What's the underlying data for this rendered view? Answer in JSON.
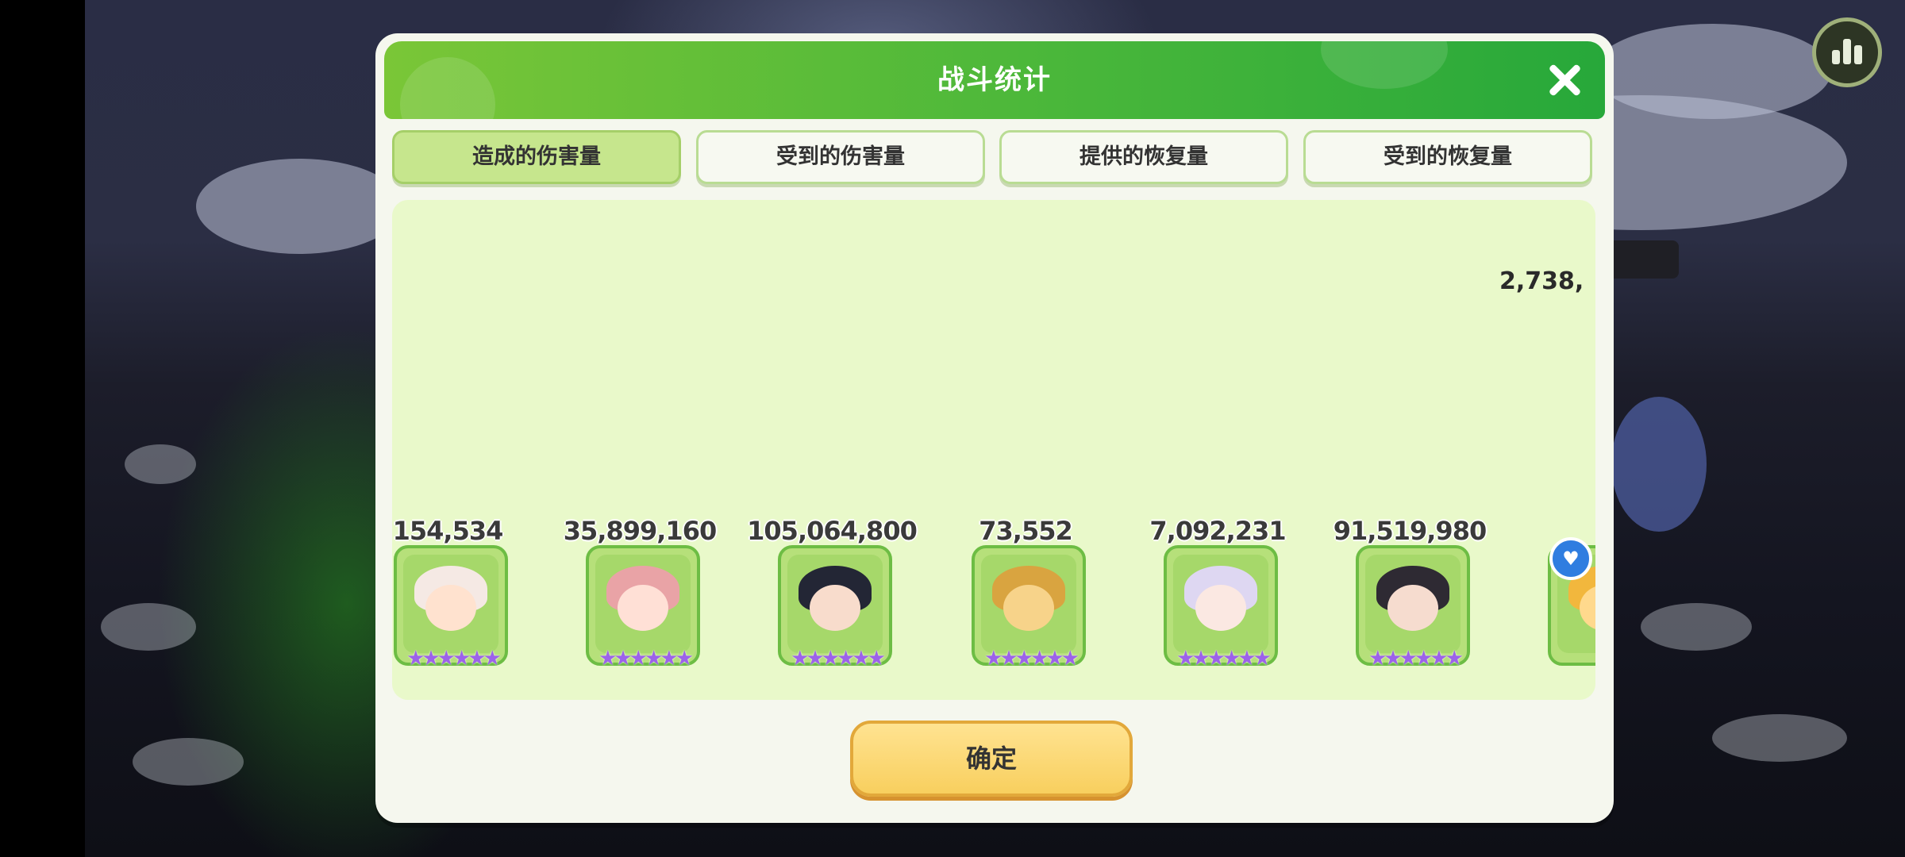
{
  "dialog": {
    "title": "战斗统计",
    "close_icon": "close-icon",
    "confirm_label": "确定"
  },
  "tabs": [
    {
      "label": "造成的伤害量",
      "active": true
    },
    {
      "label": "受到的伤害量",
      "active": false
    },
    {
      "label": "提供的恢复量",
      "active": false
    },
    {
      "label": "受到的恢复量",
      "active": false
    }
  ],
  "heroes": [
    {
      "value": "154,534",
      "stars": "★★★★★★"
    },
    {
      "value": "35,899,160",
      "stars": "★★★★★★"
    },
    {
      "value": "105,064,800",
      "stars": "★★★★★★"
    },
    {
      "value": "73,552",
      "stars": "★★★★★★"
    },
    {
      "value": "7,092,231",
      "stars": "★★★★★★"
    },
    {
      "value": "91,519,980",
      "stars": "★★★★★★"
    }
  ],
  "partial_hero": {
    "value": "2,738,"
  },
  "colors": {
    "header_green": "#4ab73a",
    "tab_active": "#c6e68d",
    "panel": "#e9f9ca",
    "confirm": "#f8cf5e",
    "star": "#9c62ea"
  },
  "icons": {
    "stats": "bar-chart-icon",
    "badge": "like-icon"
  }
}
